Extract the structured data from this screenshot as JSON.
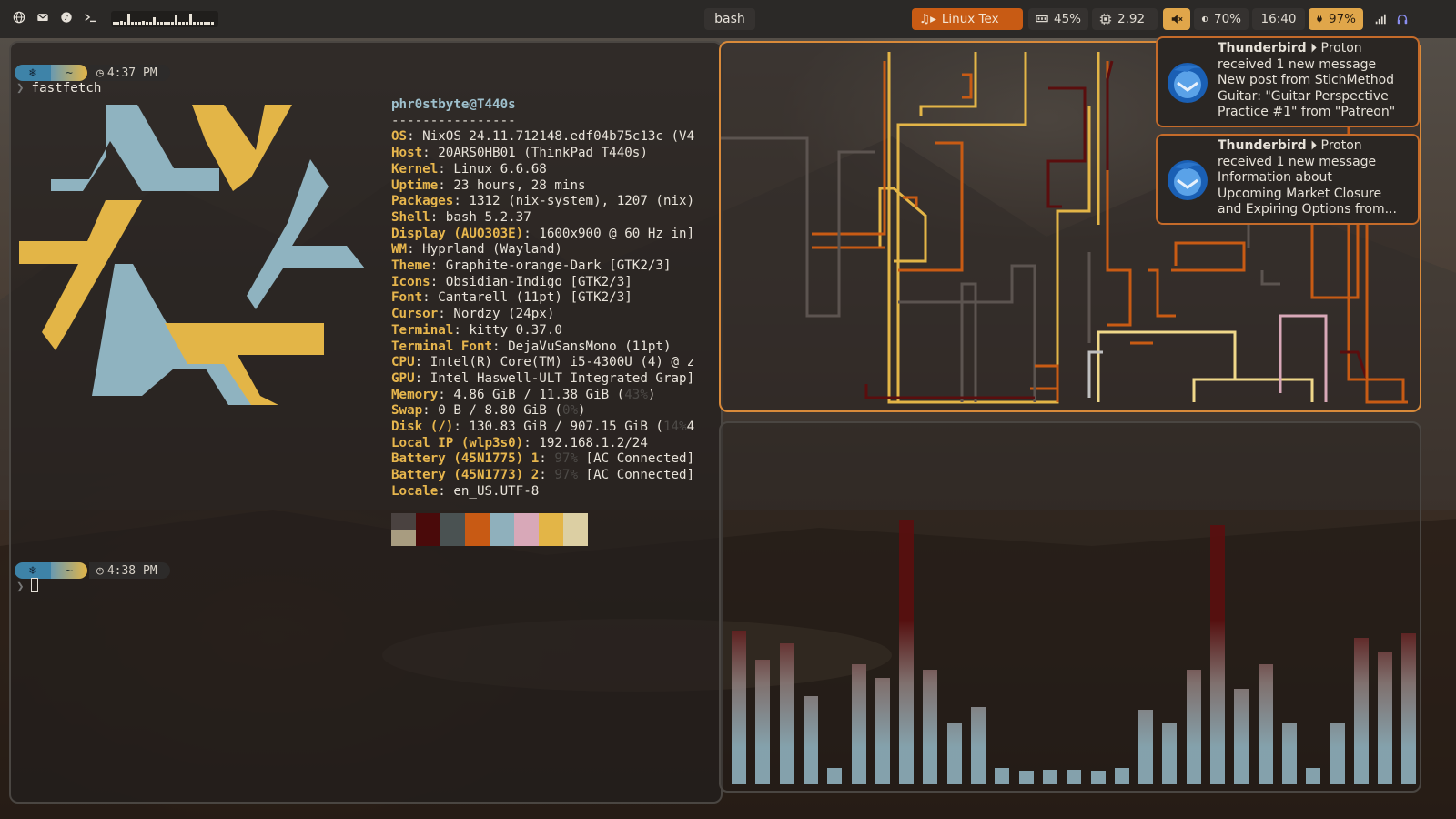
{
  "topbar": {
    "left_icons": [
      "globe-icon",
      "mail-icon",
      "music-icon",
      "terminal-icon"
    ],
    "workspace_title": "bash",
    "music": "Linux Tex",
    "cpu": "45%",
    "load": "2.92",
    "volume_icon": "speaker-muted-icon",
    "brightness": "70%",
    "clock": "16:40",
    "battery": "97%",
    "tray_icons": [
      "signal-icon",
      "headset-icon"
    ]
  },
  "terminal": {
    "prompt1_time": "4:37 PM",
    "command": "fastfetch",
    "prompt2_time": "4:38 PM",
    "prompt_home": "~",
    "header": "phr0stbyte@T440s",
    "separator": "----------------",
    "info": [
      {
        "key": "OS",
        "value": " NixOS 24.11.712148.edf04b75c13c (V4"
      },
      {
        "key": "Host",
        "value": " 20ARS0HB01 (ThinkPad T440s)"
      },
      {
        "key": "Kernel",
        "value": " Linux 6.6.68"
      },
      {
        "key": "Uptime",
        "value": " 23 hours, 28 mins"
      },
      {
        "key": "Packages",
        "value": " 1312 (nix-system), 1207 (nix)"
      },
      {
        "key": "Shell",
        "value": " bash 5.2.37"
      },
      {
        "key": "Display (AUO303E)",
        "value": " 1600x900 @ 60 Hz in]"
      },
      {
        "key": "WM",
        "value": " Hyprland (Wayland)"
      },
      {
        "key": "Theme",
        "value": " Graphite-orange-Dark [GTK2/3]"
      },
      {
        "key": "Icons",
        "value": " Obsidian-Indigo [GTK2/3]"
      },
      {
        "key": "Font",
        "value": " Cantarell (11pt) [GTK2/3]"
      },
      {
        "key": "Cursor",
        "value": " Nordzy (24px)"
      },
      {
        "key": "Terminal",
        "value": " kitty 0.37.0"
      },
      {
        "key": "Terminal Font",
        "value": " DejaVuSansMono (11pt)"
      },
      {
        "key": "CPU",
        "value": " Intel(R) Core(TM) i5-4300U (4) @ z"
      },
      {
        "key": "GPU",
        "value": " Intel Haswell-ULT Integrated Grap]"
      },
      {
        "key": "Memory",
        "value": " 4.86 GiB / 11.38 GiB (",
        "dim": "43%",
        "tail": ")"
      },
      {
        "key": "Swap",
        "value": " 0 B / 8.80 GiB (",
        "dim": "0%",
        "tail": ")"
      },
      {
        "key": "Disk (/)",
        "value": " 130.83 GiB / 907.15 GiB (",
        "dim": "14%",
        "tail": "4"
      },
      {
        "key": "Local IP (wlp3s0)",
        "value": " 192.168.1.2/24"
      },
      {
        "key": "Battery (45N1775) 1",
        "value": " ",
        "dim": "97%",
        "tail": " [AC Connected]"
      },
      {
        "key": "Battery (45N1773) 2",
        "value": " ",
        "dim": "97%",
        "tail": " [AC Connected]"
      },
      {
        "key": "Locale",
        "value": " en_US.UTF-8"
      }
    ],
    "palette_top": [
      "#4a4240",
      "#4a0a0a",
      "#4a5252",
      "#c85a14",
      "#8fb0bc",
      "#d8a8b8",
      "#e3b547",
      "#dccfa3"
    ],
    "palette_bottom": [
      "#a89c80",
      "#4a0a0a",
      "#4a5252",
      "#c85a14",
      "#8fb0bc",
      "#d8a8b8",
      "#e3b547",
      "#dccfa3"
    ]
  },
  "notifications": [
    {
      "app": "Thunderbird",
      "sub": "Proton",
      "lines": [
        "received 1 new message",
        "New post from StichMethod",
        "Guitar: \"Guitar Perspective",
        "Practice #1\" from \"Patreon\""
      ]
    },
    {
      "app": "Thunderbird",
      "sub": "Proton",
      "lines": [
        "received 1 new message",
        "Information about",
        "Upcoming Market Closure",
        "and Expiring Options from..."
      ]
    }
  ],
  "visualizer": {
    "levels": [
      0.58,
      0.47,
      0.53,
      0.33,
      0.06,
      0.45,
      0.4,
      1.0,
      0.43,
      0.23,
      0.29,
      0.06,
      0.03,
      0.05,
      0.05,
      0.03,
      0.06,
      0.28,
      0.23,
      0.43,
      0.98,
      0.36,
      0.45,
      0.23,
      0.06,
      0.23,
      0.55,
      0.5,
      0.57
    ],
    "colors": {
      "low": "#8fb0bc",
      "mid": "#8a7a78",
      "high": "#5a0e0e"
    }
  },
  "colors": {
    "accent": "#e3b547",
    "orange": "#c85b14",
    "blue": "#8fb0bc"
  }
}
